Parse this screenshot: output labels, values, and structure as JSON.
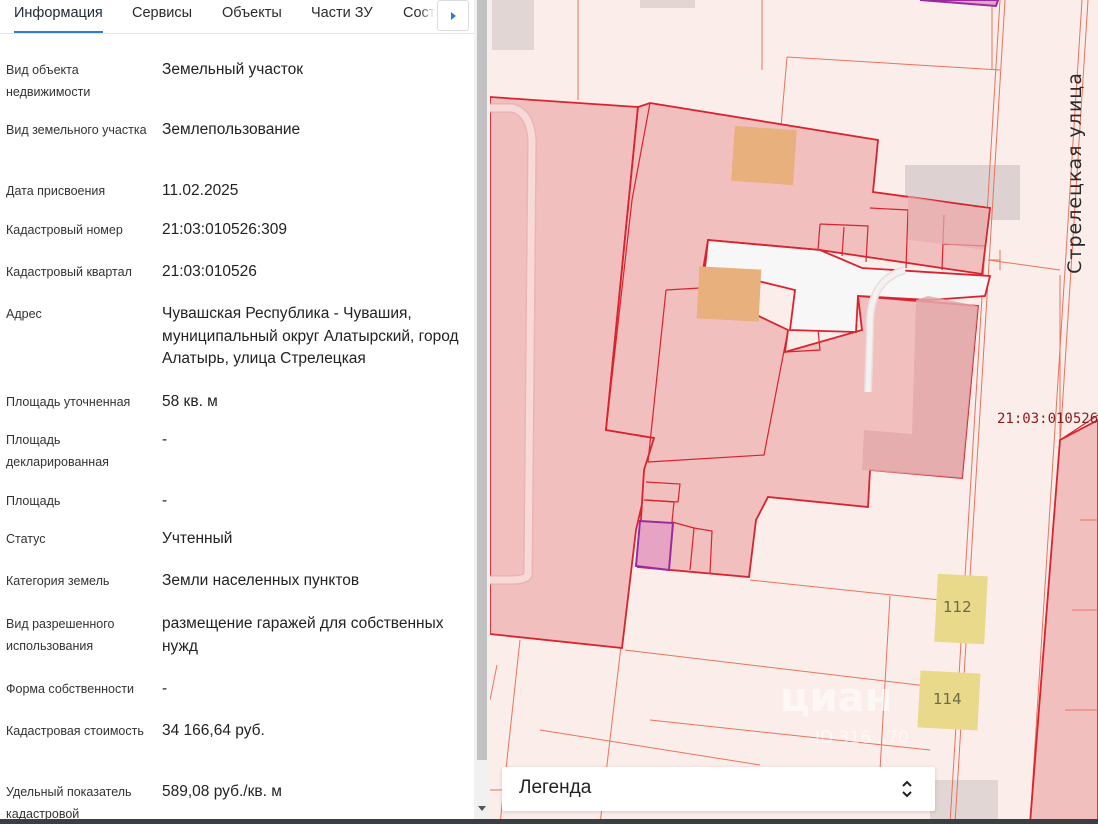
{
  "tabs": [
    {
      "label": "Информация",
      "active": true
    },
    {
      "label": "Сервисы",
      "active": false
    },
    {
      "label": "Объекты",
      "active": false
    },
    {
      "label": "Части ЗУ",
      "active": false
    },
    {
      "label": "Соста",
      "active": false
    }
  ],
  "info_rows": [
    {
      "label": "Вид объекта недвижимости",
      "value": "Земельный участок"
    },
    {
      "label": "Вид земельного участка",
      "value": "Землепользование"
    },
    {
      "label": "Дата присвоения",
      "value": "11.02.2025"
    },
    {
      "label": "Кадастровый номер",
      "value": "21:03:010526:309"
    },
    {
      "label": "Кадастровый квартал",
      "value": "21:03:010526"
    },
    {
      "label": "Адрес",
      "value": "Чувашская Республика - Чувашия, муниципальный округ Алатырский, город Алатырь, улица Стрелецкая"
    },
    {
      "label": "Площадь уточненная",
      "value": "58 кв. м"
    },
    {
      "label": "Площадь декларированная",
      "value": "-"
    },
    {
      "label": "Площадь",
      "value": "-"
    },
    {
      "label": "Статус",
      "value": "Учтенный"
    },
    {
      "label": "Категория земель",
      "value": "Земли населенных пунктов"
    },
    {
      "label": "Вид разрешенного использования",
      "value": "размещение гаражей для собственных нужд"
    },
    {
      "label": "Форма собственности",
      "value": "-"
    },
    {
      "label": "Кадастровая стоимость",
      "value": "34 166,64 руб."
    },
    {
      "label": "Удельный показатель кадастровой",
      "value": "589,08 руб./кв. м"
    }
  ],
  "map": {
    "street_name": "Стрелецкая улица",
    "quarter_label": "21:03:010526",
    "house_numbers": [
      "112",
      "114"
    ],
    "watermark": "циан",
    "watermark_id": "ID 316...70",
    "legend_title": "Легенда",
    "colors": {
      "parcel_fill": "#f2bfbf",
      "parcel_border": "#d9232e",
      "selected_parcel_fill": "#e6a3c4",
      "selected_parcel_border": "#9b2aa0",
      "building_orange": "#e8b07c",
      "building_yellow": "#e9d98a",
      "building_grey": "#d9cfcf",
      "road": "#f7f7f7"
    }
  }
}
